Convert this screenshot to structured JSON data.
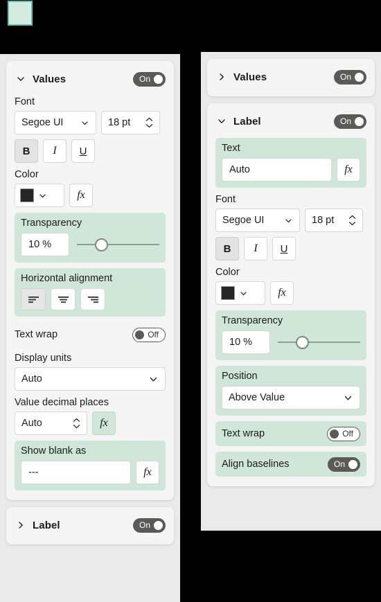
{
  "canvas": {
    "selection_marker": "selected-visual-handle"
  },
  "left_panel": {
    "values_section": {
      "title": "Values",
      "chevron": "chevron-down-icon",
      "toggle": {
        "state": "On",
        "label": "On"
      },
      "font_label": "Font",
      "font_family": "Segoe UI",
      "font_size": "18 pt",
      "style_buttons": [
        {
          "name": "bold",
          "label": "B",
          "active": true
        },
        {
          "name": "italic",
          "label": "I",
          "active": false
        },
        {
          "name": "underline",
          "label": "U",
          "active": false
        }
      ],
      "color_label": "Color",
      "color_value": "#262626",
      "color_fx": "fx",
      "transparency_label": "Transparency",
      "transparency_value": "10 %",
      "transparency_percent": 22,
      "horizontal_alignment_label": "Horizontal alignment",
      "alignment_options": [
        {
          "name": "align-left",
          "active": true
        },
        {
          "name": "align-center",
          "active": false
        },
        {
          "name": "align-right",
          "active": false
        }
      ],
      "text_wrap_label": "Text wrap",
      "text_wrap_toggle": {
        "state": "Off",
        "label": "Off"
      },
      "display_units_label": "Display units",
      "display_units_value": "Auto",
      "value_decimal_places_label": "Value decimal places",
      "value_decimal_places_value": "Auto",
      "value_decimal_places_fx": "fx",
      "show_blank_as_label": "Show blank as",
      "show_blank_as_value": "---",
      "show_blank_as_fx": "fx"
    },
    "label_section": {
      "title": "Label",
      "chevron": "chevron-right-icon",
      "toggle": {
        "state": "On",
        "label": "On"
      }
    }
  },
  "right_panel": {
    "values_section": {
      "title": "Values",
      "chevron": "chevron-right-icon",
      "toggle": {
        "state": "On",
        "label": "On"
      }
    },
    "label_section": {
      "title": "Label",
      "chevron": "chevron-down-icon",
      "toggle": {
        "state": "On",
        "label": "On"
      },
      "text_label": "Text",
      "text_value": "Auto",
      "text_fx": "fx",
      "font_label": "Font",
      "font_family": "Segoe UI",
      "font_size": "18 pt",
      "style_buttons": [
        {
          "name": "bold",
          "label": "B",
          "active": true
        },
        {
          "name": "italic",
          "label": "I",
          "active": false
        },
        {
          "name": "underline",
          "label": "U",
          "active": false
        }
      ],
      "color_label": "Color",
      "color_value": "#262626",
      "color_fx": "fx",
      "transparency_label": "Transparency",
      "transparency_value": "10 %",
      "transparency_percent": 22,
      "position_label": "Position",
      "position_value": "Above Value",
      "text_wrap_label": "Text wrap",
      "text_wrap_toggle": {
        "state": "Off",
        "label": "Off"
      },
      "align_baselines_label": "Align baselines",
      "align_baselines_toggle": {
        "state": "On",
        "label": "On"
      }
    }
  },
  "colors": {
    "highlight_group": "#cfe6d8",
    "panel_bg": "#eaeaea",
    "card_bg": "#f5f5f5",
    "toggle_on": "#5a5a57",
    "selection_border": "#5cc2b2",
    "selection_fill": "#d6ebe1"
  }
}
